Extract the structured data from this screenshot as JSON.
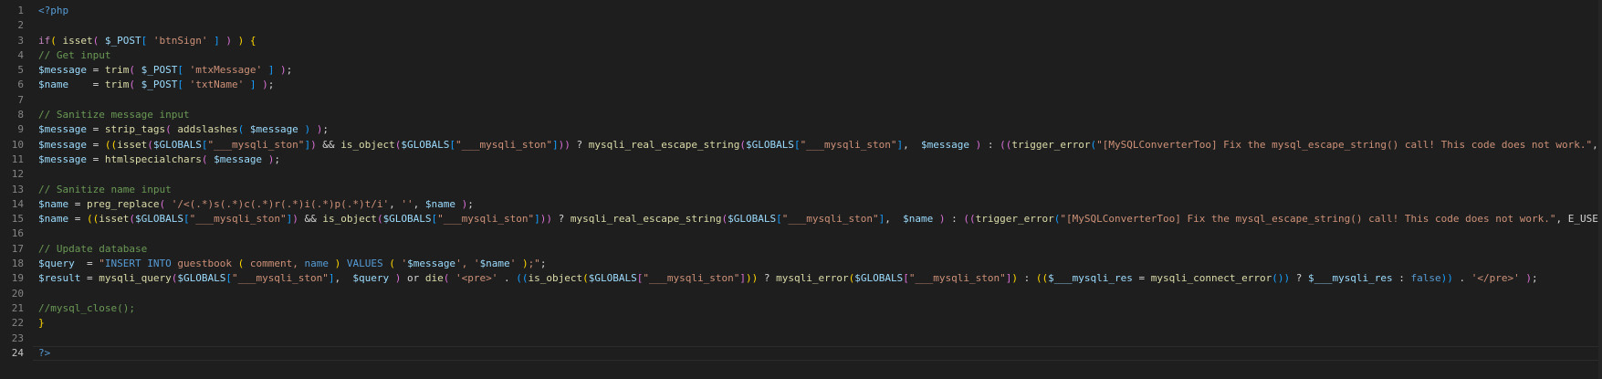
{
  "editor": {
    "language": "php",
    "active_line": 24,
    "colors": {
      "background": "#1e1e1e",
      "line_number": "#858585",
      "active_line_number": "#c6c6c6",
      "default": "#d4d4d4",
      "keyword_blue": "#569cd6",
      "control_purple": "#c586c0",
      "function_yellow": "#dcdcaa",
      "variable": "#9cdcfe",
      "string": "#ce9178",
      "comment": "#6a9955",
      "bracket_gold": "#ffd700",
      "bracket_pink": "#da70d6",
      "bracket_blue": "#179fff"
    },
    "line_numbers": [
      "1",
      "2",
      "3",
      "4",
      "5",
      "6",
      "7",
      "8",
      "9",
      "10",
      "11",
      "12",
      "13",
      "14",
      "15",
      "16",
      "17",
      "18",
      "19",
      "20",
      "21",
      "22",
      "23",
      "24"
    ],
    "lines": [
      [
        {
          "t": "<?php",
          "c": "keyword_blue"
        }
      ],
      [],
      [
        {
          "t": "if",
          "c": "control_purple"
        },
        {
          "t": "(",
          "c": "bracket_gold"
        },
        {
          "t": " isset",
          "c": "function_yellow"
        },
        {
          "t": "(",
          "c": "bracket_pink"
        },
        {
          "t": " ",
          "c": "default"
        },
        {
          "t": "$_POST",
          "c": "variable"
        },
        {
          "t": "[",
          "c": "bracket_blue"
        },
        {
          "t": " ",
          "c": "default"
        },
        {
          "t": "'btnSign'",
          "c": "string"
        },
        {
          "t": " ",
          "c": "default"
        },
        {
          "t": "]",
          "c": "bracket_blue"
        },
        {
          "t": " ",
          "c": "default"
        },
        {
          "t": ")",
          "c": "bracket_pink"
        },
        {
          "t": " ",
          "c": "default"
        },
        {
          "t": ")",
          "c": "bracket_gold"
        },
        {
          "t": " ",
          "c": "default"
        },
        {
          "t": "{",
          "c": "bracket_gold"
        }
      ],
      [
        {
          "t": "// Get input",
          "c": "comment"
        }
      ],
      [
        {
          "t": "$message",
          "c": "variable"
        },
        {
          "t": " = ",
          "c": "default"
        },
        {
          "t": "trim",
          "c": "function_yellow"
        },
        {
          "t": "(",
          "c": "bracket_pink"
        },
        {
          "t": " ",
          "c": "default"
        },
        {
          "t": "$_POST",
          "c": "variable"
        },
        {
          "t": "[",
          "c": "bracket_blue"
        },
        {
          "t": " ",
          "c": "default"
        },
        {
          "t": "'mtxMessage'",
          "c": "string"
        },
        {
          "t": " ",
          "c": "default"
        },
        {
          "t": "]",
          "c": "bracket_blue"
        },
        {
          "t": " ",
          "c": "default"
        },
        {
          "t": ")",
          "c": "bracket_pink"
        },
        {
          "t": ";",
          "c": "default"
        }
      ],
      [
        {
          "t": "$name",
          "c": "variable"
        },
        {
          "t": "    = ",
          "c": "default"
        },
        {
          "t": "trim",
          "c": "function_yellow"
        },
        {
          "t": "(",
          "c": "bracket_pink"
        },
        {
          "t": " ",
          "c": "default"
        },
        {
          "t": "$_POST",
          "c": "variable"
        },
        {
          "t": "[",
          "c": "bracket_blue"
        },
        {
          "t": " ",
          "c": "default"
        },
        {
          "t": "'txtName'",
          "c": "string"
        },
        {
          "t": " ",
          "c": "default"
        },
        {
          "t": "]",
          "c": "bracket_blue"
        },
        {
          "t": " ",
          "c": "default"
        },
        {
          "t": ")",
          "c": "bracket_pink"
        },
        {
          "t": ";",
          "c": "default"
        }
      ],
      [],
      [
        {
          "t": "// Sanitize message input",
          "c": "comment"
        }
      ],
      [
        {
          "t": "$message",
          "c": "variable"
        },
        {
          "t": " = ",
          "c": "default"
        },
        {
          "t": "strip_tags",
          "c": "function_yellow"
        },
        {
          "t": "(",
          "c": "bracket_pink"
        },
        {
          "t": " ",
          "c": "default"
        },
        {
          "t": "addslashes",
          "c": "function_yellow"
        },
        {
          "t": "(",
          "c": "bracket_blue"
        },
        {
          "t": " ",
          "c": "default"
        },
        {
          "t": "$message",
          "c": "variable"
        },
        {
          "t": " ",
          "c": "default"
        },
        {
          "t": ")",
          "c": "bracket_blue"
        },
        {
          "t": " ",
          "c": "default"
        },
        {
          "t": ")",
          "c": "bracket_pink"
        },
        {
          "t": ";",
          "c": "default"
        }
      ],
      [
        {
          "t": "$message",
          "c": "variable"
        },
        {
          "t": " = ",
          "c": "default"
        },
        {
          "t": "((",
          "c": "bracket_gold"
        },
        {
          "t": "isset",
          "c": "function_yellow"
        },
        {
          "t": "(",
          "c": "bracket_pink"
        },
        {
          "t": "$GLOBALS",
          "c": "variable"
        },
        {
          "t": "[",
          "c": "bracket_blue"
        },
        {
          "t": "\"___mysqli_ston\"",
          "c": "string"
        },
        {
          "t": "]",
          "c": "bracket_blue"
        },
        {
          "t": ")",
          "c": "bracket_pink"
        },
        {
          "t": " && ",
          "c": "default"
        },
        {
          "t": "is_object",
          "c": "function_yellow"
        },
        {
          "t": "(",
          "c": "bracket_pink"
        },
        {
          "t": "$GLOBALS",
          "c": "variable"
        },
        {
          "t": "[",
          "c": "bracket_blue"
        },
        {
          "t": "\"___mysqli_ston\"",
          "c": "string"
        },
        {
          "t": "]",
          "c": "bracket_blue"
        },
        {
          "t": "))",
          "c": "bracket_pink"
        },
        {
          "t": " ? ",
          "c": "default"
        },
        {
          "t": "mysqli_real_escape_string",
          "c": "function_yellow"
        },
        {
          "t": "(",
          "c": "bracket_pink"
        },
        {
          "t": "$GLOBALS",
          "c": "variable"
        },
        {
          "t": "[",
          "c": "bracket_blue"
        },
        {
          "t": "\"___mysqli_ston\"",
          "c": "string"
        },
        {
          "t": "]",
          "c": "bracket_blue"
        },
        {
          "t": ",  ",
          "c": "default"
        },
        {
          "t": "$message",
          "c": "variable"
        },
        {
          "t": " ",
          "c": "default"
        },
        {
          "t": ")",
          "c": "bracket_pink"
        },
        {
          "t": " : ",
          "c": "default"
        },
        {
          "t": "((",
          "c": "bracket_pink"
        },
        {
          "t": "trigger_error",
          "c": "function_yellow"
        },
        {
          "t": "(",
          "c": "bracket_blue"
        },
        {
          "t": "\"[MySQLConverterToo] Fix the mysql_escape_string() call! This code does not work.\"",
          "c": "string"
        },
        {
          "t": ", E_USER_ERROR",
          "c": "default"
        }
      ],
      [
        {
          "t": "$message",
          "c": "variable"
        },
        {
          "t": " = ",
          "c": "default"
        },
        {
          "t": "htmlspecialchars",
          "c": "function_yellow"
        },
        {
          "t": "(",
          "c": "bracket_pink"
        },
        {
          "t": " ",
          "c": "default"
        },
        {
          "t": "$message",
          "c": "variable"
        },
        {
          "t": " ",
          "c": "default"
        },
        {
          "t": ")",
          "c": "bracket_pink"
        },
        {
          "t": ";",
          "c": "default"
        }
      ],
      [],
      [
        {
          "t": "// Sanitize name input",
          "c": "comment"
        }
      ],
      [
        {
          "t": "$name",
          "c": "variable"
        },
        {
          "t": " = ",
          "c": "default"
        },
        {
          "t": "preg_replace",
          "c": "function_yellow"
        },
        {
          "t": "(",
          "c": "bracket_pink"
        },
        {
          "t": " ",
          "c": "default"
        },
        {
          "t": "'/<(.*)s(.*)c(.*)r(.*)i(.*)p(.*)t/i'",
          "c": "string"
        },
        {
          "t": ", ",
          "c": "default"
        },
        {
          "t": "''",
          "c": "string"
        },
        {
          "t": ", ",
          "c": "default"
        },
        {
          "t": "$name",
          "c": "variable"
        },
        {
          "t": " ",
          "c": "default"
        },
        {
          "t": ")",
          "c": "bracket_pink"
        },
        {
          "t": ";",
          "c": "default"
        }
      ],
      [
        {
          "t": "$name",
          "c": "variable"
        },
        {
          "t": " = ",
          "c": "default"
        },
        {
          "t": "((",
          "c": "bracket_gold"
        },
        {
          "t": "isset",
          "c": "function_yellow"
        },
        {
          "t": "(",
          "c": "bracket_pink"
        },
        {
          "t": "$GLOBALS",
          "c": "variable"
        },
        {
          "t": "[",
          "c": "bracket_blue"
        },
        {
          "t": "\"___mysqli_ston\"",
          "c": "string"
        },
        {
          "t": "]",
          "c": "bracket_blue"
        },
        {
          "t": ")",
          "c": "bracket_pink"
        },
        {
          "t": " && ",
          "c": "default"
        },
        {
          "t": "is_object",
          "c": "function_yellow"
        },
        {
          "t": "(",
          "c": "bracket_pink"
        },
        {
          "t": "$GLOBALS",
          "c": "variable"
        },
        {
          "t": "[",
          "c": "bracket_blue"
        },
        {
          "t": "\"___mysqli_ston\"",
          "c": "string"
        },
        {
          "t": "]",
          "c": "bracket_blue"
        },
        {
          "t": "))",
          "c": "bracket_pink"
        },
        {
          "t": " ? ",
          "c": "default"
        },
        {
          "t": "mysqli_real_escape_string",
          "c": "function_yellow"
        },
        {
          "t": "(",
          "c": "bracket_pink"
        },
        {
          "t": "$GLOBALS",
          "c": "variable"
        },
        {
          "t": "[",
          "c": "bracket_blue"
        },
        {
          "t": "\"___mysqli_ston\"",
          "c": "string"
        },
        {
          "t": "]",
          "c": "bracket_blue"
        },
        {
          "t": ",  ",
          "c": "default"
        },
        {
          "t": "$name",
          "c": "variable"
        },
        {
          "t": " ",
          "c": "default"
        },
        {
          "t": ")",
          "c": "bracket_pink"
        },
        {
          "t": " : ",
          "c": "default"
        },
        {
          "t": "((",
          "c": "bracket_pink"
        },
        {
          "t": "trigger_error",
          "c": "function_yellow"
        },
        {
          "t": "(",
          "c": "bracket_blue"
        },
        {
          "t": "\"[MySQLConverterToo] Fix the mysql_escape_string() call! This code does not work.\"",
          "c": "string"
        },
        {
          "t": ", E_USER_ERROR",
          "c": "default"
        }
      ],
      [],
      [
        {
          "t": "// Update database",
          "c": "comment"
        }
      ],
      [
        {
          "t": "$query",
          "c": "variable"
        },
        {
          "t": "  = ",
          "c": "default"
        },
        {
          "t": "\"",
          "c": "string"
        },
        {
          "t": "INSERT INTO",
          "c": "keyword_blue"
        },
        {
          "t": " guestbook ",
          "c": "string"
        },
        {
          "t": "(",
          "c": "bracket_gold"
        },
        {
          "t": " comment, ",
          "c": "string"
        },
        {
          "t": "name",
          "c": "keyword_blue"
        },
        {
          "t": " ",
          "c": "string"
        },
        {
          "t": ")",
          "c": "bracket_gold"
        },
        {
          "t": " ",
          "c": "string"
        },
        {
          "t": "VALUES",
          "c": "keyword_blue"
        },
        {
          "t": " ",
          "c": "string"
        },
        {
          "t": "(",
          "c": "bracket_gold"
        },
        {
          "t": " '",
          "c": "string"
        },
        {
          "t": "$message",
          "c": "variable"
        },
        {
          "t": "', '",
          "c": "string"
        },
        {
          "t": "$name",
          "c": "variable"
        },
        {
          "t": "' ",
          "c": "string"
        },
        {
          "t": ")",
          "c": "bracket_gold"
        },
        {
          "t": ";\"",
          "c": "string"
        },
        {
          "t": ";",
          "c": "default"
        }
      ],
      [
        {
          "t": "$result",
          "c": "variable"
        },
        {
          "t": " = ",
          "c": "default"
        },
        {
          "t": "mysqli_query",
          "c": "function_yellow"
        },
        {
          "t": "(",
          "c": "bracket_pink"
        },
        {
          "t": "$GLOBALS",
          "c": "variable"
        },
        {
          "t": "[",
          "c": "bracket_blue"
        },
        {
          "t": "\"___mysqli_ston\"",
          "c": "string"
        },
        {
          "t": "]",
          "c": "bracket_blue"
        },
        {
          "t": ",  ",
          "c": "default"
        },
        {
          "t": "$query",
          "c": "variable"
        },
        {
          "t": " ",
          "c": "default"
        },
        {
          "t": ")",
          "c": "bracket_pink"
        },
        {
          "t": " or ",
          "c": "default"
        },
        {
          "t": "die",
          "c": "function_yellow"
        },
        {
          "t": "(",
          "c": "bracket_pink"
        },
        {
          "t": " ",
          "c": "default"
        },
        {
          "t": "'<pre>'",
          "c": "string"
        },
        {
          "t": " . ",
          "c": "default"
        },
        {
          "t": "((",
          "c": "bracket_blue"
        },
        {
          "t": "is_object",
          "c": "function_yellow"
        },
        {
          "t": "(",
          "c": "bracket_gold"
        },
        {
          "t": "$GLOBALS",
          "c": "variable"
        },
        {
          "t": "[",
          "c": "bracket_pink"
        },
        {
          "t": "\"___mysqli_ston\"",
          "c": "string"
        },
        {
          "t": "]",
          "c": "bracket_pink"
        },
        {
          "t": "))",
          "c": "bracket_gold"
        },
        {
          "t": " ? ",
          "c": "default"
        },
        {
          "t": "mysqli_error",
          "c": "function_yellow"
        },
        {
          "t": "(",
          "c": "bracket_gold"
        },
        {
          "t": "$GLOBALS",
          "c": "variable"
        },
        {
          "t": "[",
          "c": "bracket_pink"
        },
        {
          "t": "\"___mysqli_ston\"",
          "c": "string"
        },
        {
          "t": "]",
          "c": "bracket_pink"
        },
        {
          "t": ")",
          "c": "bracket_gold"
        },
        {
          "t": " : ",
          "c": "default"
        },
        {
          "t": "((",
          "c": "bracket_gold"
        },
        {
          "t": "$___mysqli_res",
          "c": "variable"
        },
        {
          "t": " = ",
          "c": "default"
        },
        {
          "t": "mysqli_connect_error",
          "c": "function_yellow"
        },
        {
          "t": "())",
          "c": "bracket_blue"
        },
        {
          "t": " ? ",
          "c": "default"
        },
        {
          "t": "$___mysqli_res",
          "c": "variable"
        },
        {
          "t": " : ",
          "c": "default"
        },
        {
          "t": "false",
          "c": "keyword_blue"
        },
        {
          "t": "))",
          "c": "bracket_blue"
        },
        {
          "t": " . ",
          "c": "default"
        },
        {
          "t": "'</pre>'",
          "c": "string"
        },
        {
          "t": " ",
          "c": "default"
        },
        {
          "t": ")",
          "c": "bracket_pink"
        },
        {
          "t": ";",
          "c": "default"
        }
      ],
      [],
      [
        {
          "t": "//mysql_close();",
          "c": "comment"
        }
      ],
      [
        {
          "t": "}",
          "c": "bracket_gold"
        }
      ],
      [],
      [
        {
          "t": "?>",
          "c": "keyword_blue"
        }
      ]
    ]
  }
}
